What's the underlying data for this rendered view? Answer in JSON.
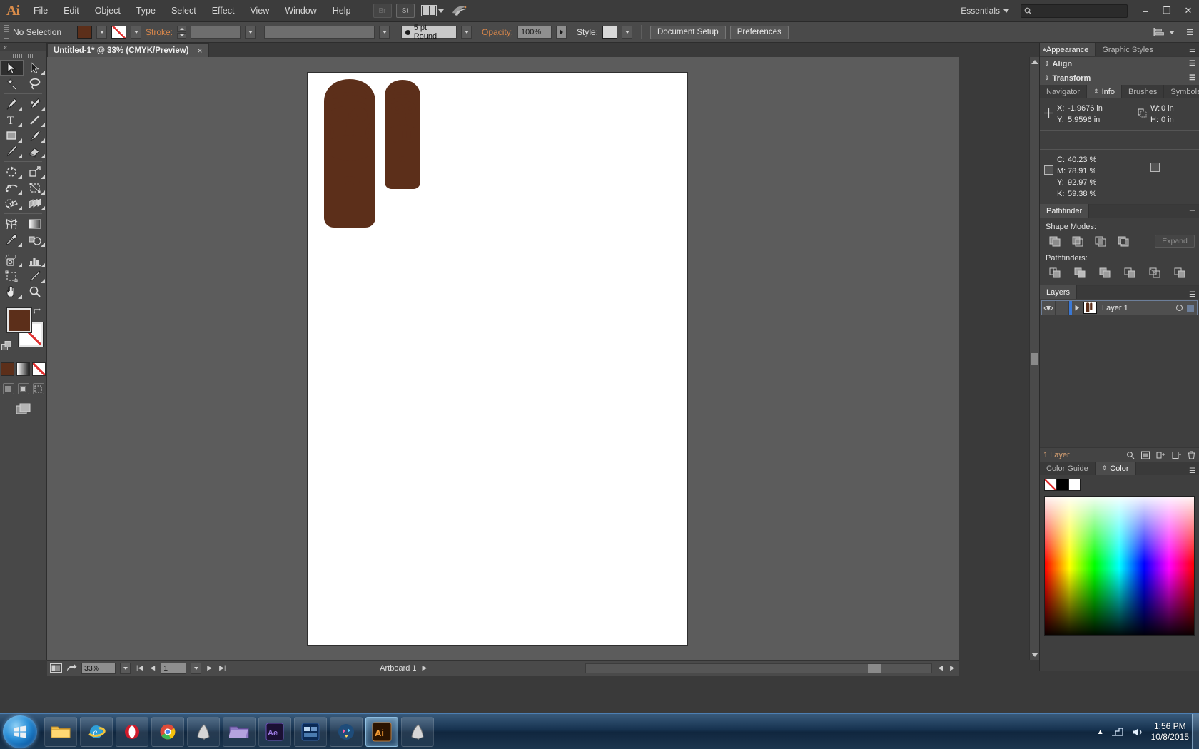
{
  "app": {
    "name": "Adobe Illustrator",
    "logo_text": "Ai"
  },
  "menubar": {
    "items": [
      "File",
      "Edit",
      "Object",
      "Type",
      "Select",
      "Effect",
      "View",
      "Window",
      "Help"
    ],
    "bridge_label": "Br",
    "stock_label": "St",
    "workspace_label": "Essentials",
    "search_placeholder": "",
    "search_value": "",
    "window_buttons": {
      "minimize": "–",
      "restore": "❐",
      "close": "✕"
    }
  },
  "controlbar": {
    "selection_status": "No Selection",
    "fill_color": "#5c2f1a",
    "stroke_color": "none",
    "stroke_label": "Stroke:",
    "stroke_weight": "",
    "stroke_profile": "",
    "brush_label": "5 pt. Round",
    "opacity_label": "Opacity:",
    "opacity_value": "100%",
    "style_label": "Style:",
    "style_swatch": "#d8d8d8",
    "document_setup_label": "Document Setup",
    "preferences_label": "Preferences"
  },
  "document": {
    "tab_title": "Untitled-1* @ 33% (CMYK/Preview)",
    "close_glyph": "×",
    "artwork_color": "#5c2f1a"
  },
  "toolbar": {
    "tools": [
      {
        "name": "selection-tool",
        "label": "Selection",
        "selected": true
      },
      {
        "name": "direct-selection-tool",
        "label": "Direct Selection"
      },
      {
        "name": "magic-wand-tool",
        "label": "Magic Wand"
      },
      {
        "name": "lasso-tool",
        "label": "Lasso"
      },
      {
        "name": "pen-tool",
        "label": "Pen"
      },
      {
        "name": "add-anchor-point-tool",
        "label": "Add Anchor Point"
      },
      {
        "name": "type-tool",
        "label": "Type"
      },
      {
        "name": "line-segment-tool",
        "label": "Line Segment"
      },
      {
        "name": "rectangle-tool",
        "label": "Rectangle"
      },
      {
        "name": "paintbrush-tool",
        "label": "Paintbrush"
      },
      {
        "name": "pencil-tool",
        "label": "Pencil"
      },
      {
        "name": "eraser-tool",
        "label": "Eraser"
      },
      {
        "name": "rotate-tool",
        "label": "Rotate"
      },
      {
        "name": "scale-tool",
        "label": "Scale"
      },
      {
        "name": "width-tool",
        "label": "Width"
      },
      {
        "name": "free-transform-tool",
        "label": "Free Transform"
      },
      {
        "name": "shape-builder-tool",
        "label": "Shape Builder"
      },
      {
        "name": "perspective-grid-tool",
        "label": "Perspective Grid"
      },
      {
        "name": "mesh-tool",
        "label": "Mesh"
      },
      {
        "name": "gradient-tool",
        "label": "Gradient"
      },
      {
        "name": "eyedropper-tool",
        "label": "Eyedropper"
      },
      {
        "name": "blend-tool",
        "label": "Blend"
      },
      {
        "name": "symbol-sprayer-tool",
        "label": "Symbol Sprayer"
      },
      {
        "name": "column-graph-tool",
        "label": "Column Graph"
      },
      {
        "name": "artboard-tool",
        "label": "Artboard"
      },
      {
        "name": "slice-tool",
        "label": "Slice"
      },
      {
        "name": "hand-tool",
        "label": "Hand"
      },
      {
        "name": "zoom-tool",
        "label": "Zoom"
      }
    ],
    "fill_color": "#5c2f1a",
    "stroke_color": "none",
    "color_mode": "#5c2f1a",
    "gradient_mode": "gradient",
    "none_mode": "none"
  },
  "panels": {
    "top_tabs": [
      {
        "label": "Appearance",
        "active": true
      },
      {
        "label": "Graphic Styles",
        "active": false
      }
    ],
    "align": {
      "label": "Align"
    },
    "transform": {
      "label": "Transform"
    },
    "info_tabs": [
      {
        "label": "Navigator",
        "active": false
      },
      {
        "label": "Info",
        "active": true
      },
      {
        "label": "Brushes",
        "active": false
      },
      {
        "label": "Symbols",
        "active": false
      }
    ],
    "info": {
      "x_label": "X:",
      "x_value": "-1.9676 in",
      "y_label": "Y:",
      "y_value": "5.9596 in",
      "w_label": "W:",
      "w_value": "0 in",
      "h_label": "H:",
      "h_value": "0 in",
      "c_label": "C:",
      "c_value": "40.23 %",
      "m_label": "M:",
      "m_value": "78.91 %",
      "y2_label": "Y:",
      "y2_value": "92.97 %",
      "k_label": "K:",
      "k_value": "59.38 %"
    },
    "pathfinder": {
      "tab_label": "Pathfinder",
      "shape_modes_label": "Shape Modes:",
      "pathfinders_label": "Pathfinders:",
      "expand_label": "Expand",
      "shape_mode_buttons": [
        "unite",
        "minus-front",
        "intersect",
        "exclude"
      ],
      "pathfinder_buttons": [
        "divide",
        "trim",
        "merge",
        "crop",
        "outline",
        "minus-back"
      ]
    },
    "layers": {
      "tab_label": "Layers",
      "rows": [
        {
          "name": "Layer 1",
          "visible": true,
          "locked": false,
          "selected": true
        }
      ],
      "footer_count": "1 Layer"
    },
    "color_tabs": [
      {
        "label": "Color Guide",
        "active": false
      },
      {
        "label": "Color",
        "active": true
      }
    ],
    "color": {
      "swatches": [
        "none",
        "#000000",
        "#ffffff"
      ]
    }
  },
  "statusbar": {
    "zoom_value": "33%",
    "artboard_number": "1",
    "artboard_label": "Artboard 1"
  },
  "taskbar": {
    "start_label": "Start",
    "tasks": [
      {
        "name": "windows-explorer",
        "label": "Windows Explorer",
        "active": false
      },
      {
        "name": "internet-explorer",
        "label": "Internet Explorer",
        "active": false
      },
      {
        "name": "opera-browser",
        "label": "Opera",
        "active": false
      },
      {
        "name": "google-chrome",
        "label": "Google Chrome",
        "active": false
      },
      {
        "name": "inkscape",
        "label": "Inkscape",
        "active": false
      },
      {
        "name": "folder-app",
        "label": "Folder",
        "active": false
      },
      {
        "name": "after-effects",
        "label": "After Effects",
        "active": false
      },
      {
        "name": "media-app",
        "label": "Media",
        "active": false
      },
      {
        "name": "design-app",
        "label": "Design App",
        "active": false
      },
      {
        "name": "adobe-illustrator",
        "label": "Adobe Illustrator",
        "active": true
      },
      {
        "name": "inkscape-2",
        "label": "Inkscape",
        "active": false
      }
    ],
    "clock_time": "1:56 PM",
    "clock_date": "10/8/2015"
  }
}
